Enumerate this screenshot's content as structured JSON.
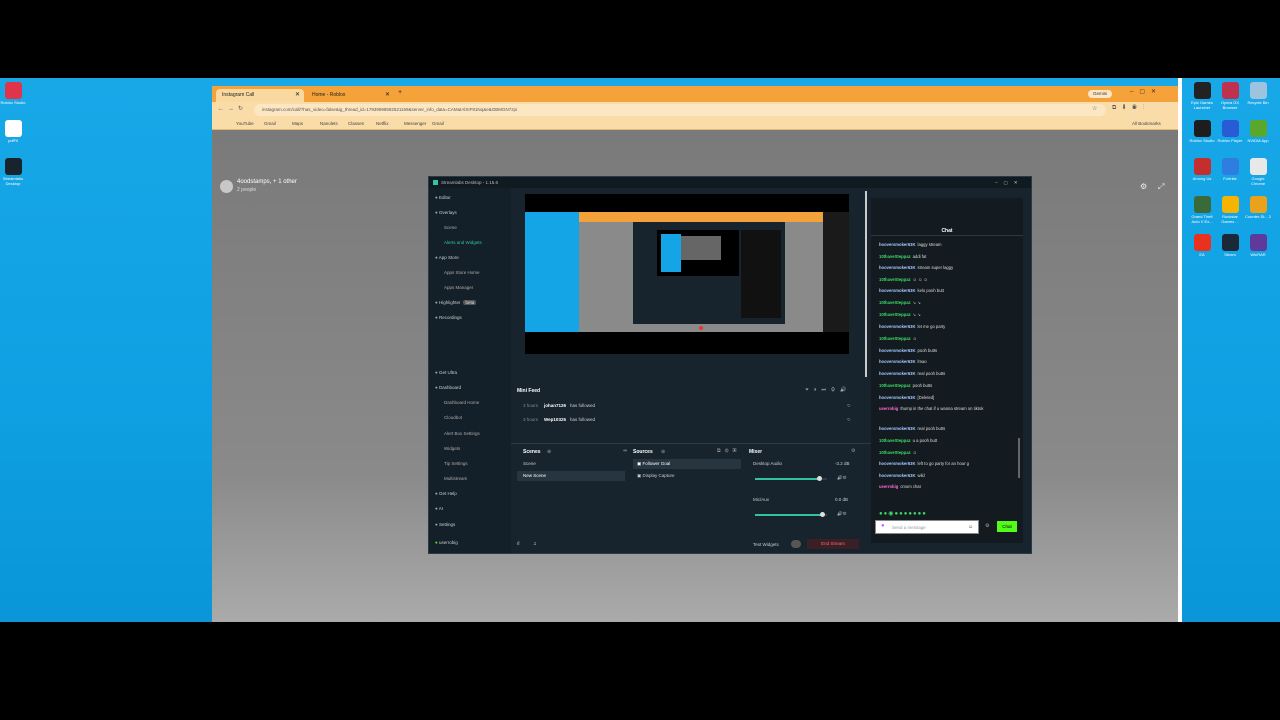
{
  "desktop": {
    "left_icons": [
      {
        "label": "Roblox Studio",
        "color": "#e0344c",
        "icon": "roblox-studio-icon"
      },
      {
        "label": "pdfFil",
        "color": "#ffffff",
        "icon": "document-icon"
      },
      {
        "label": "Streamlabs Desktop",
        "color": "#17242d",
        "icon": "streamlabs-icon"
      }
    ],
    "right_icons": [
      {
        "label": "Epic Games Launcher",
        "color": "#222222",
        "icon": "epic-games-icon"
      },
      {
        "label": "Opera GX Browser",
        "color": "#c0304f",
        "icon": "opera-gx-icon"
      },
      {
        "label": "Recycle Bin",
        "color": "#9ec3df",
        "icon": "recycle-bin-icon"
      },
      {
        "label": "Roblox Studio",
        "color": "#1d1d1d",
        "icon": "roblox-studio-icon"
      },
      {
        "label": "Roblox Player",
        "color": "#2a5bd7",
        "icon": "roblox-player-icon"
      },
      {
        "label": "NVIDIA App",
        "color": "#5aa72e",
        "icon": "nvidia-icon"
      },
      {
        "label": "Among Us",
        "color": "#c42e2e",
        "icon": "among-us-icon"
      },
      {
        "label": "Fortnite",
        "color": "#2f7de0",
        "icon": "fortnite-icon"
      },
      {
        "label": "Google Chrome",
        "color": "#e8e8e8",
        "icon": "chrome-icon"
      },
      {
        "label": "Grand Theft Auto V Ex...",
        "color": "#3a6a3a",
        "icon": "gta-icon"
      },
      {
        "label": "Rockstar Games ...",
        "color": "#f4b400",
        "icon": "rockstar-icon"
      },
      {
        "label": "Counter-St... 2",
        "color": "#e9a21b",
        "icon": "counter-strike-icon"
      },
      {
        "label": "EA",
        "color": "#e8321f",
        "icon": "ea-icon"
      },
      {
        "label": "Steam",
        "color": "#1b2838",
        "icon": "steam-icon"
      },
      {
        "label": "WinRAR",
        "color": "#5d3a9b",
        "icon": "winrar-icon"
      }
    ]
  },
  "browser": {
    "tabs": [
      {
        "label": "Instagram Call",
        "active": true
      },
      {
        "label": "Home - Roblox",
        "active": false
      }
    ],
    "profile_label": "Gemini",
    "address": "instagram.com/call/?has_video=false&ig_thread_id=17939998592521169&server_info_data=CAMaIAlXIF91Nq&e&OBMGN7zpi",
    "bookmarks": [
      "YouTube",
      "Gmail",
      "Maps",
      "Nanolets",
      "Classes",
      "Netflix",
      "Messenger",
      "Gmail"
    ],
    "all_bookmarks": "All Bookmarks"
  },
  "call": {
    "title": "4oodstamps, + 1 other",
    "subtitle": "2 people"
  },
  "streamlabs": {
    "title": "Streamlabs Desktop - 1.15.6",
    "nav": [
      {
        "label": "Editor",
        "kind": "main",
        "icon": "editor-icon"
      },
      {
        "label": "Overlays",
        "kind": "main",
        "icon": "overlays-icon"
      },
      {
        "label": "Scene",
        "kind": "sub"
      },
      {
        "label": "Alerts and Widgets",
        "kind": "sub-hl"
      },
      {
        "label": "App Store",
        "kind": "main",
        "icon": "app-store-icon"
      },
      {
        "label": "Apps Store Home",
        "kind": "sub"
      },
      {
        "label": "Apps Manager",
        "kind": "sub"
      },
      {
        "label": "Highlighter",
        "kind": "main",
        "icon": "highlighter-icon"
      },
      {
        "label": "Recordings",
        "kind": "main",
        "icon": "recordings-icon"
      },
      {
        "label": "Get Ultra",
        "kind": "main",
        "icon": "ultra-icon"
      },
      {
        "label": "Dashboard",
        "kind": "main",
        "icon": "dashboard-icon"
      },
      {
        "label": "Dashboard Home",
        "kind": "sub"
      },
      {
        "label": "Cloudbot",
        "kind": "sub"
      },
      {
        "label": "Alert Box Settings",
        "kind": "sub"
      },
      {
        "label": "Widgets",
        "kind": "sub"
      },
      {
        "label": "Tip Settings",
        "kind": "sub"
      },
      {
        "label": "Multistream",
        "kind": "sub"
      },
      {
        "label": "Get Help",
        "kind": "main",
        "icon": "help-icon"
      },
      {
        "label": "AI",
        "kind": "main",
        "icon": "ai-icon"
      },
      {
        "label": "Settings",
        "kind": "main",
        "icon": "settings-icon"
      },
      {
        "label": "userrobig",
        "kind": "main",
        "icon": "kick-icon"
      }
    ],
    "beta_badge": "beta",
    "mini_feed": {
      "title": "Mini Feed",
      "rows": [
        {
          "time": "3 hours",
          "user": "johan7126",
          "action": "has followed"
        },
        {
          "time": "3 hours",
          "user": "Wep10325",
          "action": "has followed"
        }
      ]
    },
    "scenes": {
      "title": "Scenes",
      "items": [
        "Scene",
        "New Scene"
      ]
    },
    "sources": {
      "title": "Sources",
      "items": [
        "Follower Goal",
        "Display Capture"
      ]
    },
    "mixer": {
      "title": "Mixer",
      "channels": [
        {
          "name": "Desktop Audio",
          "db": "-3.2 dB",
          "level": 0.9
        },
        {
          "name": "Mic/Aux",
          "db": "0.0 dB",
          "level": 0.95
        }
      ]
    },
    "footer": {
      "test_widgets": "Test Widgets",
      "end_stream": "End Stream"
    },
    "live": {
      "timer": "Live 00:36:06",
      "viewers": "5 viewers",
      "refresh_chat": "Refresh Chat"
    },
    "chat": {
      "title": "Chat",
      "placeholder": "Send a message",
      "send": "Chat",
      "messages": [
        {
          "user": "hooversmoker63K",
          "text": "laggy stream",
          "c": "u1"
        },
        {
          "user": "10thaveSteppaz",
          "text": "addi fat",
          "c": "u2"
        },
        {
          "user": "hooversmoker63K",
          "text": "stream super laggy",
          "c": "u1"
        },
        {
          "user": "10thaveSteppaz",
          "text": "☺ ☺ ☺",
          "c": "u2"
        },
        {
          "user": "hooversmoker63K",
          "text": "kelo pooh butt",
          "c": "u1"
        },
        {
          "user": "10thaveSteppaz",
          "text": "↘ ↘",
          "c": "u2"
        },
        {
          "user": "10thaveSteppaz",
          "text": "↘ ↘",
          "c": "u2"
        },
        {
          "user": "hooversmoker63K",
          "text": "let me go party",
          "c": "u1"
        },
        {
          "user": "10thaveSteppaz",
          "text": "☺",
          "c": "u2"
        },
        {
          "user": "hooversmoker63K",
          "text": "pooh butts",
          "c": "u1"
        },
        {
          "user": "hooversmoker63K",
          "text": "lmao",
          "c": "u1"
        },
        {
          "user": "hooversmoker63K",
          "text": "real pooh butts",
          "c": "u1"
        },
        {
          "user": "10thaveSteppaz",
          "text": "pooh butts",
          "c": "u2"
        },
        {
          "user": "hooversmoker63K",
          "text": "[Deleted]",
          "c": "u1"
        },
        {
          "user": "userrobig",
          "text": "thump in the chat if u wanna stream on tiktok",
          "c": "u3"
        },
        {
          "user": "hooversmoker63K",
          "text": "real pooh butts",
          "c": "u1"
        },
        {
          "user": "10thaveSteppaz",
          "text": "u a pooh butt",
          "c": "u2"
        },
        {
          "user": "10thaveSteppaz",
          "text": "☺",
          "c": "u2"
        },
        {
          "user": "hooversmoker63K",
          "text": "left to go party for an hour g",
          "c": "u1"
        },
        {
          "user": "hooversmoker63K",
          "text": "wild",
          "c": "u1"
        },
        {
          "user": "userrobig",
          "text": "cmom chat",
          "c": "u3"
        }
      ]
    }
  }
}
